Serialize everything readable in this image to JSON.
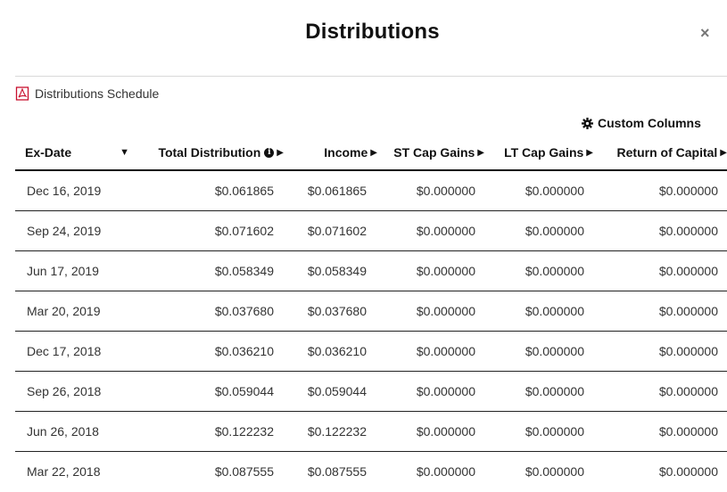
{
  "modal": {
    "title": "Distributions",
    "close_glyph": "×",
    "schedule_link": "Distributions Schedule",
    "schedule_icon": "pdf-icon",
    "custom_columns_label": "Custom Columns",
    "custom_columns_icon": "gear-icon"
  },
  "table": {
    "headers": {
      "ex_date": "Ex-Date",
      "total": "Total Distribution",
      "income": "Income",
      "st": "ST Cap Gains",
      "lt": "LT Cap Gains",
      "roc": "Return of Capital"
    },
    "glyphs": {
      "sort_down": "▼",
      "sort_right": "▶",
      "info": "i"
    },
    "rows": [
      {
        "date": "Dec 16, 2019",
        "total": "$0.061865",
        "income": "$0.061865",
        "st": "$0.000000",
        "lt": "$0.000000",
        "roc": "$0.000000"
      },
      {
        "date": "Sep 24, 2019",
        "total": "$0.071602",
        "income": "$0.071602",
        "st": "$0.000000",
        "lt": "$0.000000",
        "roc": "$0.000000"
      },
      {
        "date": "Jun 17, 2019",
        "total": "$0.058349",
        "income": "$0.058349",
        "st": "$0.000000",
        "lt": "$0.000000",
        "roc": "$0.000000"
      },
      {
        "date": "Mar 20, 2019",
        "total": "$0.037680",
        "income": "$0.037680",
        "st": "$0.000000",
        "lt": "$0.000000",
        "roc": "$0.000000"
      },
      {
        "date": "Dec 17, 2018",
        "total": "$0.036210",
        "income": "$0.036210",
        "st": "$0.000000",
        "lt": "$0.000000",
        "roc": "$0.000000"
      },
      {
        "date": "Sep 26, 2018",
        "total": "$0.059044",
        "income": "$0.059044",
        "st": "$0.000000",
        "lt": "$0.000000",
        "roc": "$0.000000"
      },
      {
        "date": "Jun 26, 2018",
        "total": "$0.122232",
        "income": "$0.122232",
        "st": "$0.000000",
        "lt": "$0.000000",
        "roc": "$0.000000"
      },
      {
        "date": "Mar 22, 2018",
        "total": "$0.087555",
        "income": "$0.087555",
        "st": "$0.000000",
        "lt": "$0.000000",
        "roc": "$0.000000"
      }
    ]
  },
  "colors": {
    "pdf_icon": "#c8102e",
    "header_rule": "#111111",
    "row_rule": "#222222"
  }
}
